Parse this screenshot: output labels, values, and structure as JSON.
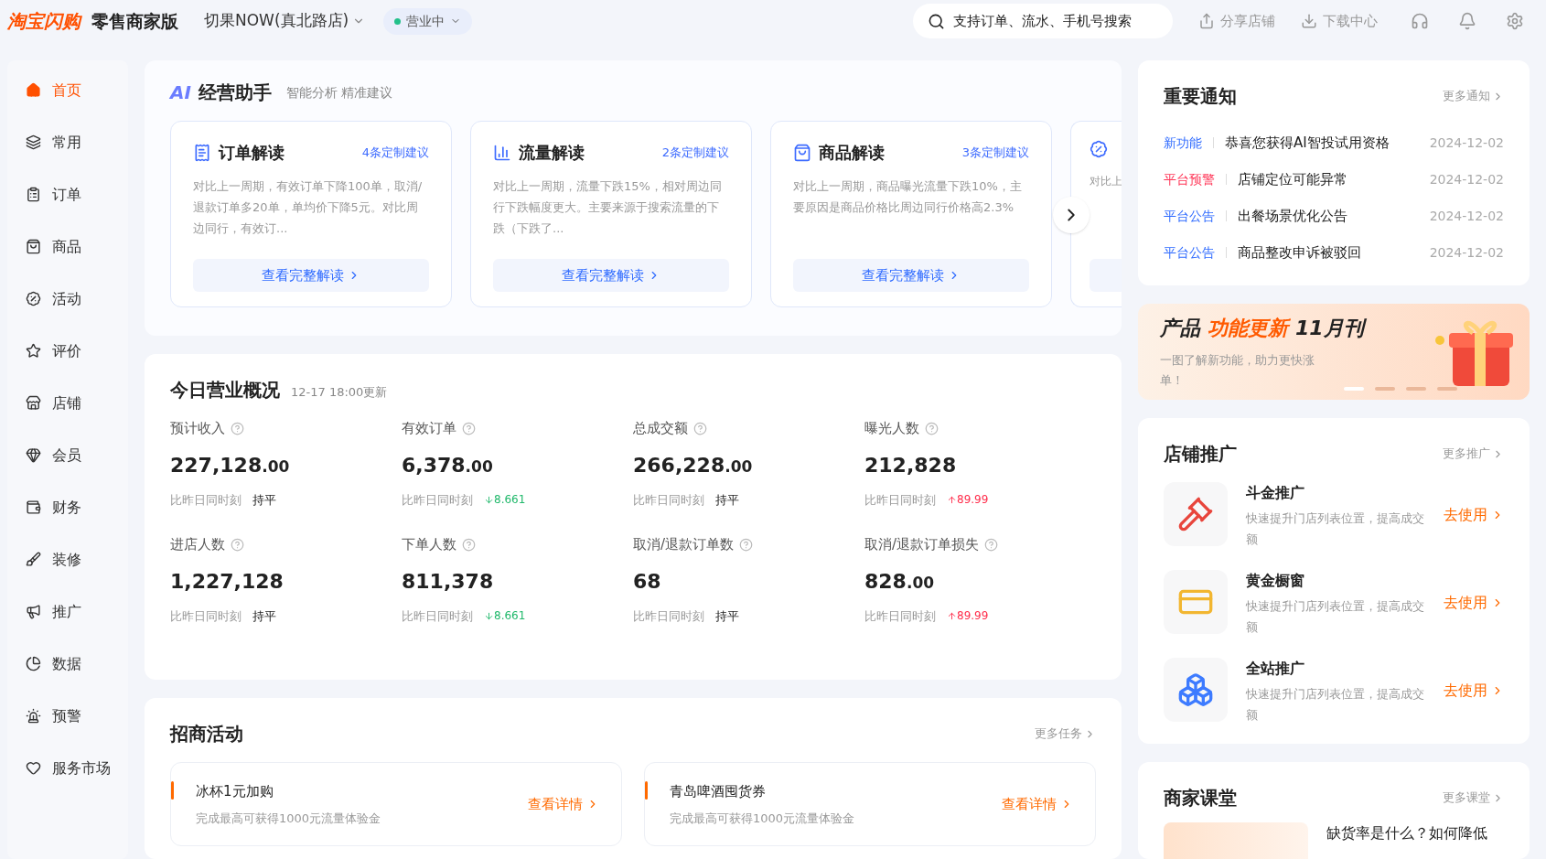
{
  "header": {
    "logo": "淘宝闪购",
    "edition": "零售商家版",
    "store": "切果NOW(真北路店)",
    "status": "营业中",
    "status_on": true,
    "search_placeholder": "支持订单、流水、手机号搜索",
    "actions": [
      "分享店铺",
      "下载中心"
    ]
  },
  "sidebar": {
    "items": [
      {
        "label": "首页",
        "selected": true
      },
      {
        "label": "常用",
        "selected": false
      },
      {
        "label": "订单",
        "selected": false
      },
      {
        "label": "商品",
        "selected": false
      },
      {
        "label": "活动",
        "selected": false
      },
      {
        "label": "评价",
        "selected": false
      },
      {
        "label": "店铺",
        "selected": false
      },
      {
        "label": "会员",
        "selected": false
      },
      {
        "label": "财务",
        "selected": false
      },
      {
        "label": "装修",
        "selected": false
      },
      {
        "label": "推广",
        "selected": false
      },
      {
        "label": "数据",
        "selected": false
      },
      {
        "label": "预警",
        "selected": false
      },
      {
        "label": "服务市场",
        "selected": false
      }
    ]
  },
  "assistant": {
    "badge": "AI",
    "title": "经营助手",
    "subtitle": "智能分析 精准建议",
    "cards": [
      {
        "title": "订单解读",
        "count": "4条定制建议",
        "text": "对比上一周期，有效订单下降100单，取消/退款订单多20单，单均价下降5元。对比周边同行，有效订...",
        "button": "查看完整解读"
      },
      {
        "title": "流量解读",
        "count": "2条定制建议",
        "text": "对比上一周期，流量下跌15%，相对周边同行下跌幅度更大。主要来源于搜索流量的下跌（下跌了...",
        "button": "查看完整解读"
      },
      {
        "title": "商品解读",
        "count": "3条定制建议",
        "text": "对比上一周期，商品曝光流量下跌10%，主要原因是商品价格比周边同行价格高2.3%",
        "button": "查看完整解读"
      }
    ],
    "partial_card_text": "对比上"
  },
  "overview": {
    "title": "今日营业概况",
    "updated": "12-17 18:00更新",
    "metrics": [
      {
        "label": "预计收入",
        "value": "227,128",
        "decimal": ".00",
        "compare_label": "比昨日同时刻",
        "kind": "flat",
        "change": "持平"
      },
      {
        "label": "有效订单",
        "value": "6,378",
        "decimal": ".00",
        "compare_label": "比昨日同时刻",
        "kind": "down",
        "change": "8.661"
      },
      {
        "label": "总成交额",
        "value": "266,228",
        "decimal": ".00",
        "compare_label": "比昨日同时刻",
        "kind": "flat",
        "change": "持平"
      },
      {
        "label": "曝光人数",
        "value": "212,828",
        "compare_label": "比昨日同时刻",
        "kind": "up",
        "change": "89.99"
      },
      {
        "label": "进店人数",
        "value": "1,227,128",
        "compare_label": "比昨日同时刻",
        "kind": "flat",
        "change": "持平"
      },
      {
        "label": "下单人数",
        "value": "811,378",
        "compare_label": "比昨日同时刻",
        "kind": "down",
        "change": "8.661"
      },
      {
        "label": "取消/退款订单数",
        "value": "68",
        "compare_label": "比昨日同时刻",
        "kind": "flat",
        "change": "持平"
      },
      {
        "label": "取消/退款订单损失",
        "value": "828",
        "decimal": ".00",
        "compare_label": "比昨日同时刻",
        "kind": "up",
        "change": "89.99"
      }
    ]
  },
  "campaigns": {
    "title": "招商活动",
    "more": "更多任务",
    "items": [
      {
        "title": "冰杯1元加购",
        "desc": "完成最高可获得1000元流量体验金",
        "action": "查看详情"
      },
      {
        "title": "青岛啤酒囤货券",
        "desc": "完成最高可获得1000元流量体验金",
        "action": "查看详情"
      }
    ]
  },
  "notices": {
    "title": "重要通知",
    "more": "更多通知",
    "items": [
      {
        "tag": "新功能",
        "color": "#2f6bff",
        "text": "恭喜您获得AI智投试用资格",
        "date": "2024-12-02"
      },
      {
        "tag": "平台预警",
        "color": "#ff3355",
        "text": "店铺定位可能异常",
        "date": "2024-12-02"
      },
      {
        "tag": "平台公告",
        "color": "#2f6bff",
        "text": "出餐场景优化公告",
        "date": "2024-12-02"
      },
      {
        "tag": "平台公告",
        "color": "#2f6bff",
        "text": "商品整改申诉被驳回",
        "date": "2024-12-02"
      }
    ]
  },
  "banner": {
    "title_parts": [
      {
        "text": "产品",
        "highlight": false
      },
      {
        "text": "功能更新",
        "highlight": true
      },
      {
        "text": "11月刊",
        "highlight": false
      }
    ],
    "subtitle": "一图了解新功能，助力更快涨单！",
    "dots": [
      {
        "selected": true
      },
      {
        "selected": false
      },
      {
        "selected": false
      },
      {
        "selected": false
      }
    ]
  },
  "promotion": {
    "title": "店铺推广",
    "more": "更多推广",
    "items": [
      {
        "title": "斗金推广",
        "desc": "快速提升门店列表位置，提高成交额",
        "action": "去使用"
      },
      {
        "title": "黄金橱窗",
        "desc": "快速提升门店列表位置，提高成交额",
        "action": "去使用"
      },
      {
        "title": "全站推广",
        "desc": "快速提升门店列表位置，提高成交额",
        "action": "去使用"
      }
    ]
  },
  "courses": {
    "title": "商家课堂",
    "more": "更多课堂",
    "items": [
      {
        "title": "缺货率是什么？如何降低"
      }
    ]
  }
}
